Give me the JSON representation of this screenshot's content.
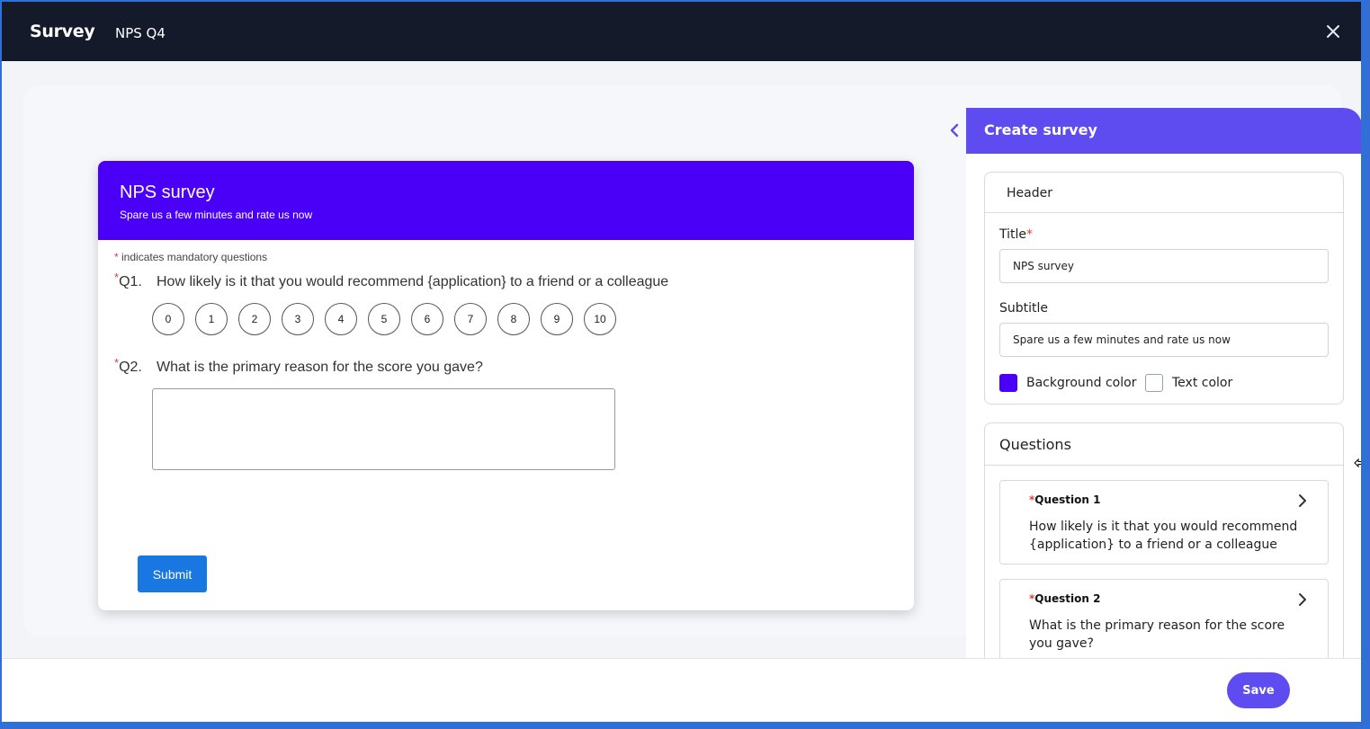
{
  "app": {
    "brand": "Survey",
    "document_name": "NPS Q4"
  },
  "colors": {
    "topbar": "#151a2b",
    "survey_header": "#4a00f6",
    "accent": "#5f4cf0",
    "submit": "#1877e0",
    "required": "#d8432e"
  },
  "survey": {
    "title": "NPS survey",
    "subtitle": "Spare us a few minutes and rate us now",
    "mandatory_note": "indicates mandatory questions",
    "required_mark": "*",
    "questions": [
      {
        "number": "Q1.",
        "text": "How likely is it that you would recommend {application} to a friend or a colleague"
      },
      {
        "number": "Q2.",
        "text": "What is the primary reason for the score you gave?"
      }
    ],
    "scale": [
      "0",
      "1",
      "2",
      "3",
      "4",
      "5",
      "6",
      "7",
      "8",
      "9",
      "10"
    ],
    "submit_label": "Submit"
  },
  "panel": {
    "title": "Create survey",
    "header_section": {
      "label": "Header",
      "title_label": "Title",
      "title_value": "NPS survey",
      "subtitle_label": "Subtitle",
      "subtitle_value": "Spare us a few minutes and rate us now",
      "background_color_label": "Background color",
      "background_color": "#4a00f6",
      "text_color_label": "Text color",
      "text_color": "#ffffff"
    },
    "questions_section": {
      "label": "Questions",
      "items": [
        {
          "label": "Question 1",
          "text": "How likely is it that you would recommend {application} to a friend or a colleague"
        },
        {
          "label": "Question 2",
          "text": "What is the primary reason for the score you gave?"
        }
      ]
    }
  },
  "footer": {
    "save_label": "Save"
  }
}
